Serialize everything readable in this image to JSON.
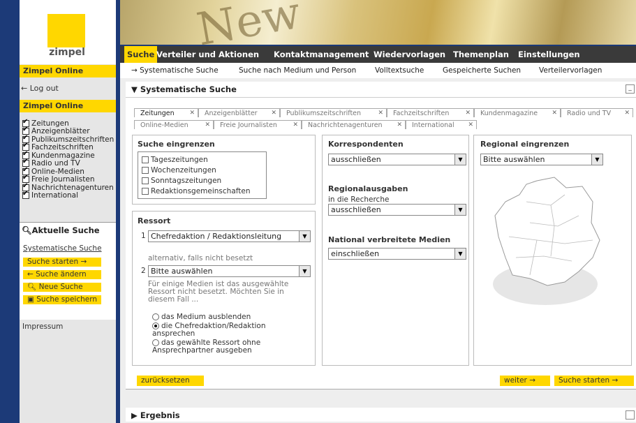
{
  "logo": {
    "text": "zimpel"
  },
  "sidebar": {
    "section1": "Zimpel Online",
    "logout": "← Log out",
    "section2": "Zimpel Online",
    "media_types": [
      {
        "label": "Zeitungen",
        "checked": true
      },
      {
        "label": "Anzeigenblätter",
        "checked": true
      },
      {
        "label": "Publikumszeitschriften",
        "checked": true
      },
      {
        "label": "Fachzeitschriften",
        "checked": true
      },
      {
        "label": "Kundenmagazine",
        "checked": true
      },
      {
        "label": "Radio und TV",
        "checked": true
      },
      {
        "label": "Online-Medien",
        "checked": true
      },
      {
        "label": "Freie Journalisten",
        "checked": true
      },
      {
        "label": "Nachrichtenagenturen",
        "checked": true
      },
      {
        "label": "International",
        "checked": true
      }
    ],
    "current_search": {
      "title": "Aktuelle Suche",
      "type": "Systematische Suche",
      "buttons": [
        "Suche starten →",
        "← Suche ändern",
        "Neue Suche",
        "Suche speichern"
      ]
    },
    "impressum": "Impressum"
  },
  "nav": {
    "items": [
      "Suche",
      "Verteiler und Aktionen",
      "Kontaktmanagement",
      "Wiedervorlagen",
      "Themenplan",
      "Einstellungen"
    ],
    "active": "Suche"
  },
  "subnav": {
    "items": [
      "→ Systematische Suche",
      "Suche nach Medium und Person",
      "Volltextsuche",
      "Gespeicherte Suchen",
      "Verteilervorlagen"
    ]
  },
  "panel": {
    "title": "Systematische Suche"
  },
  "tabs_row1": [
    "Zeitungen",
    "Anzeigenblätter",
    "Publikumszeitschriften",
    "Fachzeitschriften",
    "Kundenmagazine",
    "Radio und TV"
  ],
  "tabs_row2": [
    "Online-Medien",
    "Freie Journalisten",
    "Nachrichtenagenturen",
    "International"
  ],
  "suche_eingrenzen": {
    "title": "Suche eingrenzen",
    "options": [
      "Tageszeitungen",
      "Wochenzeitungen",
      "Sonntagszeitungen",
      "Redaktionsgemeinschaften"
    ]
  },
  "ressort": {
    "title": "Ressort",
    "sel1_num": "1",
    "sel1": "Chefredaktion / Redaktionsleitung",
    "alt_text": "alternativ, falls nicht besetzt",
    "sel2_num": "2",
    "sel2": "Bitte auswählen",
    "info": "Für einige Medien ist das ausgewählte Ressort nicht besetzt. Möchten Sie in diesem Fall ...",
    "radios": [
      {
        "label": "das Medium ausblenden",
        "on": false
      },
      {
        "label": "die Chefredaktion/Redaktion ansprechen",
        "on": true
      },
      {
        "label": "das gewählte Ressort ohne Ansprechpartner ausgeben",
        "on": false
      }
    ]
  },
  "korrespondenten": {
    "title": "Korrespondenten",
    "value": "ausschließen"
  },
  "regionalausgaben": {
    "title": "Regionalausgaben",
    "sub": "in die Recherche",
    "value": "ausschließen"
  },
  "national": {
    "title": "National verbreitete Medien",
    "value": "einschließen"
  },
  "regional": {
    "title": "Regional eingrenzen",
    "value": "Bitte auswählen"
  },
  "buttons": {
    "reset": "zurücksetzen",
    "next": "weiter →",
    "start": "Suche starten →"
  },
  "ergebnis": {
    "title": "Ergebnis"
  }
}
